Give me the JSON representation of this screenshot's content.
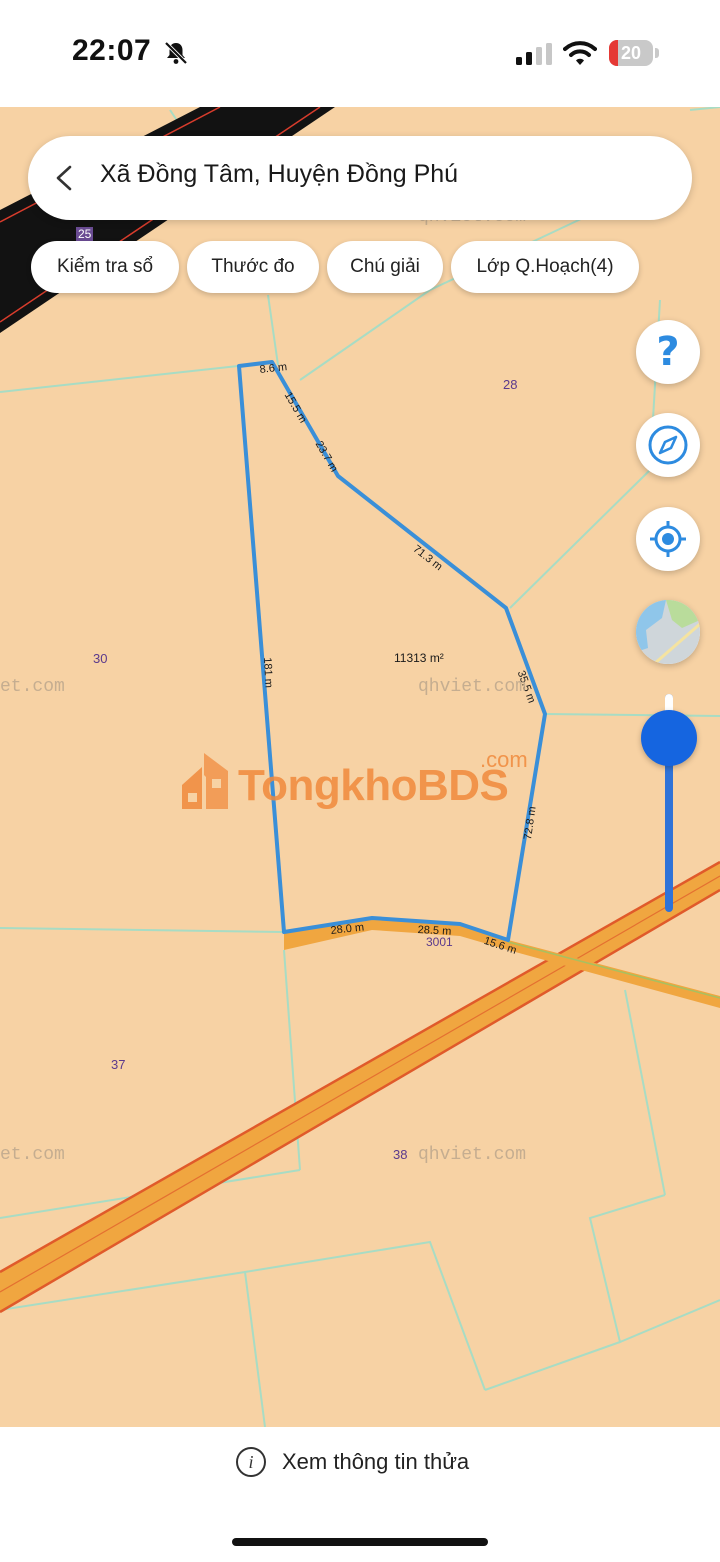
{
  "status_bar": {
    "time": "22:07",
    "battery": "20",
    "battery_level_percent": 20
  },
  "header": {
    "location": "Xã Đồng Tâm, Huyện Đồng Phú"
  },
  "chips": [
    {
      "label": "Kiểm tra sổ"
    },
    {
      "label": "Thước đo"
    },
    {
      "label": "Chú giải"
    },
    {
      "label": "Lớp Q.Hoạch(4)"
    }
  ],
  "map": {
    "parcel_ids": [
      "25",
      "28",
      "30",
      "37",
      "38",
      "3001"
    ],
    "area": "11313 m²",
    "edges": [
      "8.6 m",
      "15.5 m",
      "23.7 m",
      "71.3 m",
      "35.5 m",
      "72.8 m",
      "15.6 m",
      "28.5 m",
      "28.0 m",
      "181 m"
    ],
    "watermarks": [
      "qhviet.com",
      "et.com",
      "qhviet.com",
      "et.com",
      "qhviet.com",
      "qhviet.com"
    ],
    "brand_watermark": {
      "main": "TongkhoBDS",
      "suffix": ".com"
    },
    "colors": {
      "land": "#f7d2a4",
      "parcel_outline": "#3a8fd8",
      "road": "#f0a640",
      "road_border": "#e05a2a",
      "boundary_lines": "#a8dcc4"
    }
  },
  "controls": {
    "help": "?",
    "compass_icon": "compass-icon",
    "locate_icon": "locate-icon",
    "layer_icon": "map-layer-icon",
    "zoom_level_fraction": 0.9
  },
  "bottom": {
    "info_label": "Xem thông tin thửa"
  }
}
